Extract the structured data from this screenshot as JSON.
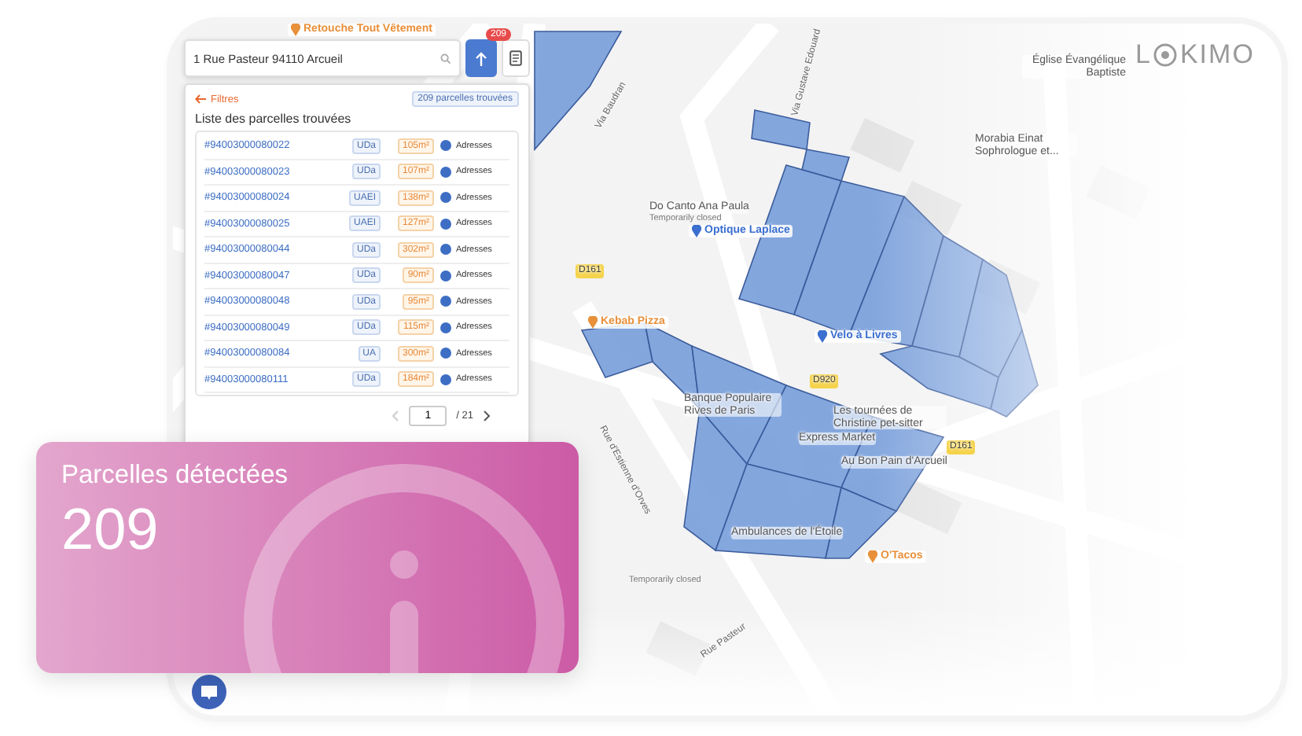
{
  "logo": {
    "left": "L",
    "right": "KIMO"
  },
  "search": {
    "value": "1 Rue Pasteur 94110 Arcueil",
    "badge": "209"
  },
  "panel": {
    "back": "Filtres",
    "count": "209 parcelles trouvées",
    "title": "Liste des parcelles trouvées"
  },
  "parcels": [
    {
      "id": "#94003000080022",
      "zone": "UDa",
      "area": "105m²",
      "link": "Adresses"
    },
    {
      "id": "#94003000080023",
      "zone": "UDa",
      "area": "107m²",
      "link": "Adresses"
    },
    {
      "id": "#94003000080024",
      "zone": "UAEI",
      "area": "138m²",
      "link": "Adresses"
    },
    {
      "id": "#94003000080025",
      "zone": "UAEI",
      "area": "127m²",
      "link": "Adresses"
    },
    {
      "id": "#94003000080044",
      "zone": "UDa",
      "area": "302m²",
      "link": "Adresses"
    },
    {
      "id": "#94003000080047",
      "zone": "UDa",
      "area": "90m²",
      "link": "Adresses"
    },
    {
      "id": "#94003000080048",
      "zone": "UDa",
      "area": "95m²",
      "link": "Adresses"
    },
    {
      "id": "#94003000080049",
      "zone": "UDa",
      "area": "115m²",
      "link": "Adresses"
    },
    {
      "id": "#94003000080084",
      "zone": "UA",
      "area": "300m²",
      "link": "Adresses"
    },
    {
      "id": "#94003000080111",
      "zone": "UDa",
      "area": "184m²",
      "link": "Adresses"
    }
  ],
  "pagination": {
    "page": "1",
    "total": "/ 21"
  },
  "stat_card": {
    "title": "Parcelles détectées",
    "value": "209"
  },
  "map_labels": [
    {
      "kind": "poi",
      "text": "Retouche Tout Vêtement",
      "color": "#e8903a"
    },
    {
      "kind": "street",
      "text": "Via Baudran"
    },
    {
      "kind": "street",
      "text": "Via Gustave Edouard"
    },
    {
      "kind": "place",
      "text": "Église Évangélique Baptiste"
    },
    {
      "kind": "place",
      "text": "Morabia Einat Sophrologue et..."
    },
    {
      "kind": "place",
      "text": "Do Canto Ana Paula"
    },
    {
      "kind": "note",
      "text": "Temporarily closed"
    },
    {
      "kind": "poi",
      "text": "Optique Laplace",
      "color": "#3b6fd0"
    },
    {
      "kind": "road",
      "text": "D161"
    },
    {
      "kind": "poi",
      "text": "Kebab Pizza",
      "color": "#e8903a"
    },
    {
      "kind": "poi",
      "text": "Velo à Livres",
      "color": "#3b6fd0"
    },
    {
      "kind": "road",
      "text": "D920"
    },
    {
      "kind": "road",
      "text": "D161"
    },
    {
      "kind": "place",
      "text": "Banque Populaire Rives de Paris"
    },
    {
      "kind": "place",
      "text": "Les tournées de Christine pet-sitter"
    },
    {
      "kind": "place",
      "text": "Express Market"
    },
    {
      "kind": "place",
      "text": "Au Bon Pain d'Arcueil"
    },
    {
      "kind": "street",
      "text": "Rue d'Estienne d'Orves"
    },
    {
      "kind": "place",
      "text": "Ambulances de l'Étoile"
    },
    {
      "kind": "poi",
      "text": "O'Tacos",
      "color": "#e8903a"
    },
    {
      "kind": "note",
      "text": "Temporarily closed"
    },
    {
      "kind": "street",
      "text": "Rue Pasteur"
    }
  ]
}
